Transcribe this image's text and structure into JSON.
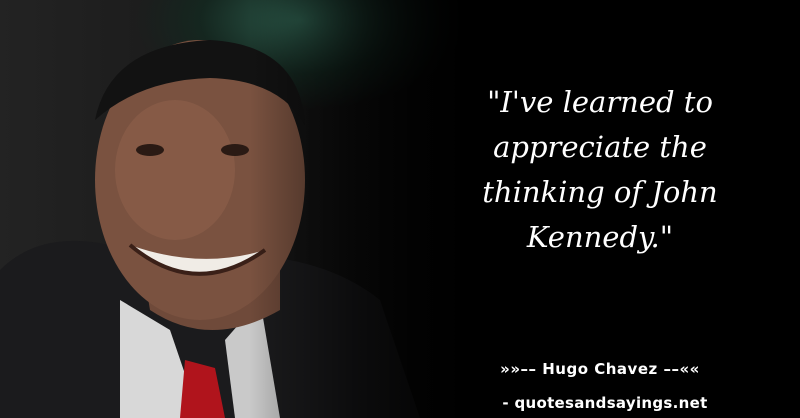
{
  "quote": {
    "text": "\"I've learned to appreciate the thinking of John Kennedy.\""
  },
  "attribution": {
    "author_line": "»»–– Hugo Chavez ––««",
    "source_line": "- quotesandsayings.net"
  },
  "colors": {
    "background": "#000000",
    "text": "#ffffff"
  }
}
